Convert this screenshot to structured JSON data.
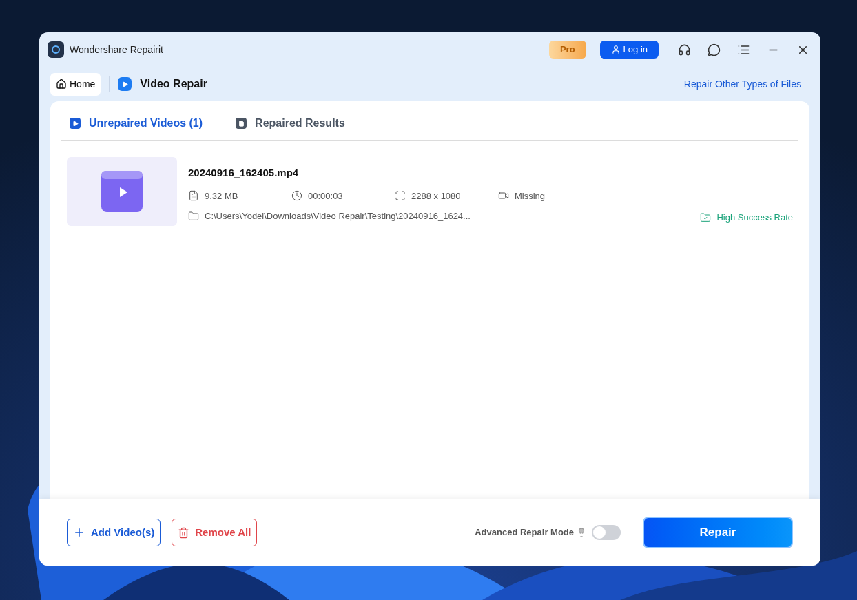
{
  "window": {
    "title": "Wondershare Repairit"
  },
  "title_bar": {
    "pro_badge": "Pro",
    "login_button": "Log in"
  },
  "nav": {
    "home": "Home",
    "page_title": "Video Repair",
    "other_link": "Repair Other Types of Files"
  },
  "tabs": [
    {
      "label": "Unrepaired Videos (1)",
      "selected": true
    },
    {
      "label": "Repaired Results",
      "selected": false
    }
  ],
  "videos": [
    {
      "name": "20240916_162405.mp4",
      "size": "9.32 MB",
      "duration": "00:00:03",
      "resolution": "2288 x 1080",
      "audio": "Missing",
      "path": "C:\\Users\\Yodel\\Downloads\\Video Repair\\Testing\\20240916_1624...",
      "status": "High Success Rate"
    }
  ],
  "footer": {
    "add_button": "Add Video(s)",
    "remove_button": "Remove All",
    "advanced_mode": {
      "label": "Advanced Repair Mode",
      "on": false
    },
    "repair_button": "Repair"
  }
}
